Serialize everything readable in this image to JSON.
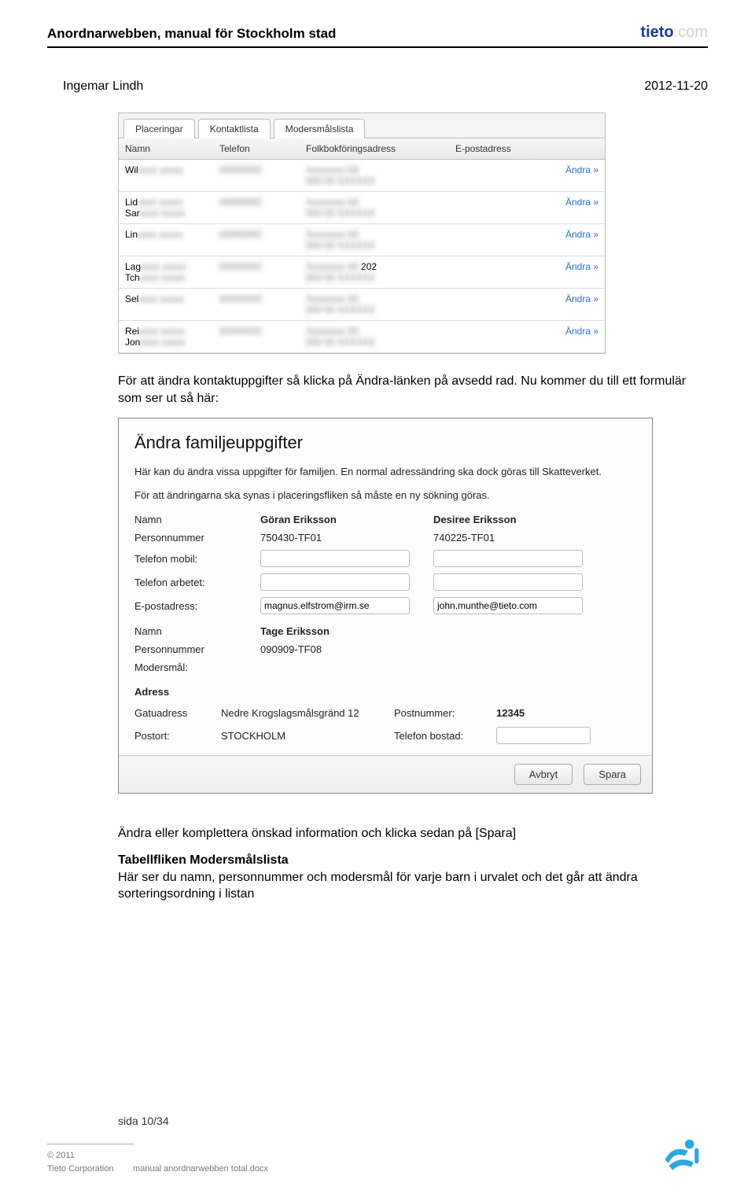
{
  "doc": {
    "title": "Anordnarwebben, manual för Stockholm stad",
    "brand_main": "tieto",
    "brand_dot": ".",
    "brand_com": "com",
    "author": "Ingemar Lindh",
    "date": "2012-11-20"
  },
  "shot1": {
    "tabs": [
      "Placeringar",
      "Kontaktlista",
      "Modersmålslista"
    ],
    "headers": {
      "name": "Namn",
      "tel": "Telefon",
      "addr": "Folkbokföringsadress",
      "mail": "E-postadress"
    },
    "action_label": "Ändra »",
    "rows": [
      {
        "name": "Wil",
        "name2": "",
        "tel": "blurred",
        "addr": "blurred blurred",
        "extra": ""
      },
      {
        "name": "Lid",
        "name2": "Sar",
        "tel": "blurred",
        "addr": "blurred blurred",
        "extra": ""
      },
      {
        "name": "Lin",
        "name2": "",
        "tel": "blurred",
        "addr": "blurred blurred",
        "extra": ""
      },
      {
        "name": "Lag",
        "name2": "Tch",
        "tel": "blurred",
        "addr": "blurred blurred",
        "extra": "202"
      },
      {
        "name": "Sel",
        "name2": "",
        "tel": "blurred",
        "addr": "blurred blurred",
        "extra": ""
      },
      {
        "name": "Rei",
        "name2": "Jon",
        "tel": "",
        "addr": "blurred blurred",
        "extra": ""
      }
    ]
  },
  "para1": "För att ändra kontaktuppgifter så klicka på Ändra-länken på avsedd rad. Nu kommer du till ett formulär som ser ut så här:",
  "shot2": {
    "title": "Ändra familjeuppgifter",
    "lead1": "Här kan du ändra vissa uppgifter för familjen. En normal adressändring ska dock göras till Skatteverket.",
    "lead2": "För att ändringarna ska synas i placeringsfliken så måste en ny sökning göras.",
    "labels": {
      "namn": "Namn",
      "pnr": "Personnummer",
      "tel_mobil": "Telefon mobil:",
      "tel_arb": "Telefon arbetet:",
      "email": "E-postadress:",
      "modersmal": "Modersmål:",
      "adress": "Adress",
      "gatu": "Gatuadress",
      "postort": "Postort:",
      "postnr": "Postnummer:",
      "tel_bost": "Telefon bostad:"
    },
    "p1": {
      "namn": "Göran Eriksson",
      "pnr": "750430-TF01",
      "email": "magnus.elfstrom@irm.se"
    },
    "p2": {
      "namn": "Desiree Eriksson",
      "pnr": "740225-TF01",
      "email": "john.munthe@tieto.com"
    },
    "child": {
      "namn": "Tage Eriksson",
      "pnr": "090909-TF08"
    },
    "addr": {
      "gatu": "Nedre Krogslagsmålsgränd 12",
      "postort": "STOCKHOLM",
      "postnr": "12345",
      "tel_bost": ""
    },
    "buttons": {
      "cancel": "Avbryt",
      "save": "Spara"
    }
  },
  "para2": "Ändra eller komplettera önskad information och klicka sedan på [Spara]",
  "section": {
    "title": "Tabellfliken Modersmålslista",
    "body": "Här ser du namn, personnummer och modersmål för varje barn i urvalet och det går att ändra sorteringsordning i listan"
  },
  "footer": {
    "page": "sida 10/34",
    "copyright": "© 2011",
    "corp": "Tieto Corporation",
    "file": "manual anordnarwebben total.docx"
  }
}
